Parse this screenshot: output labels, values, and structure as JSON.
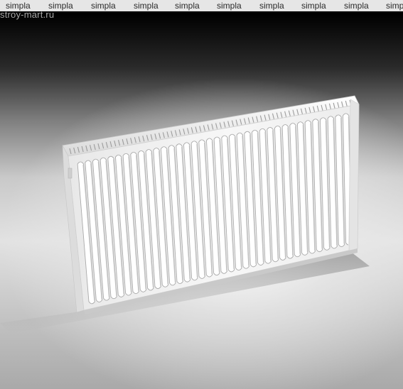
{
  "watermark": {
    "repeat_text": [
      "simpla",
      "simpla",
      "simpla",
      "simpla",
      "simpla",
      "simpla",
      "simpla",
      "simpla",
      "simpla",
      "simp"
    ],
    "site": "stroy-mart.ru"
  },
  "image": {
    "subject": "white panel radiator",
    "colors": {
      "panel": "#f2f2f2",
      "shadow": "#9a9a9a",
      "background_dark": "#000000"
    }
  }
}
